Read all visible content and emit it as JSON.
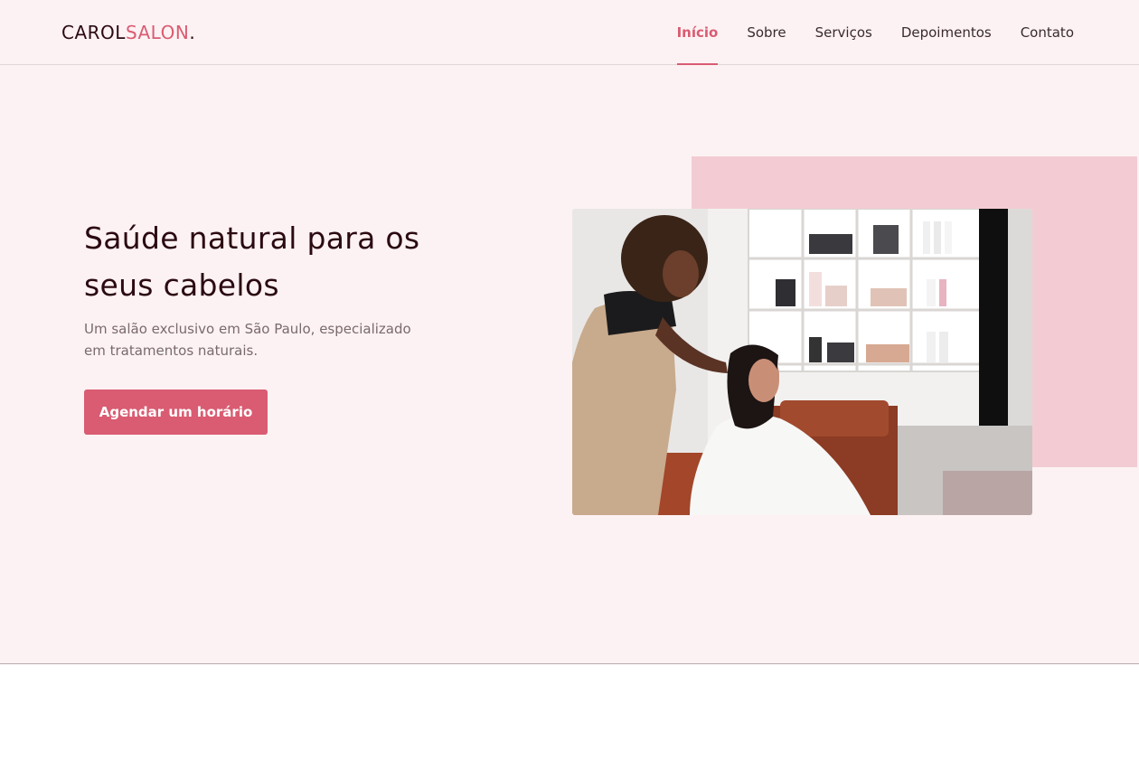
{
  "header": {
    "logo_part1": "CAROL",
    "logo_part2": "SALON",
    "logo_dot": "."
  },
  "nav": {
    "items": [
      {
        "label": "Início",
        "active": true
      },
      {
        "label": "Sobre",
        "active": false
      },
      {
        "label": "Serviços",
        "active": false
      },
      {
        "label": "Depoimentos",
        "active": false
      },
      {
        "label": "Contato",
        "active": false
      }
    ]
  },
  "hero": {
    "title": "Saúde natural para os seus cabelos",
    "subtitle": "Um salão exclusivo em São Paulo, especializado em tratamentos naturais.",
    "cta_label": "Agendar um horário"
  },
  "colors": {
    "accent": "#d95c72",
    "hero_bg": "#fdf2f3",
    "pink_block": "#f3ccd3",
    "heading": "#2b0a12"
  }
}
